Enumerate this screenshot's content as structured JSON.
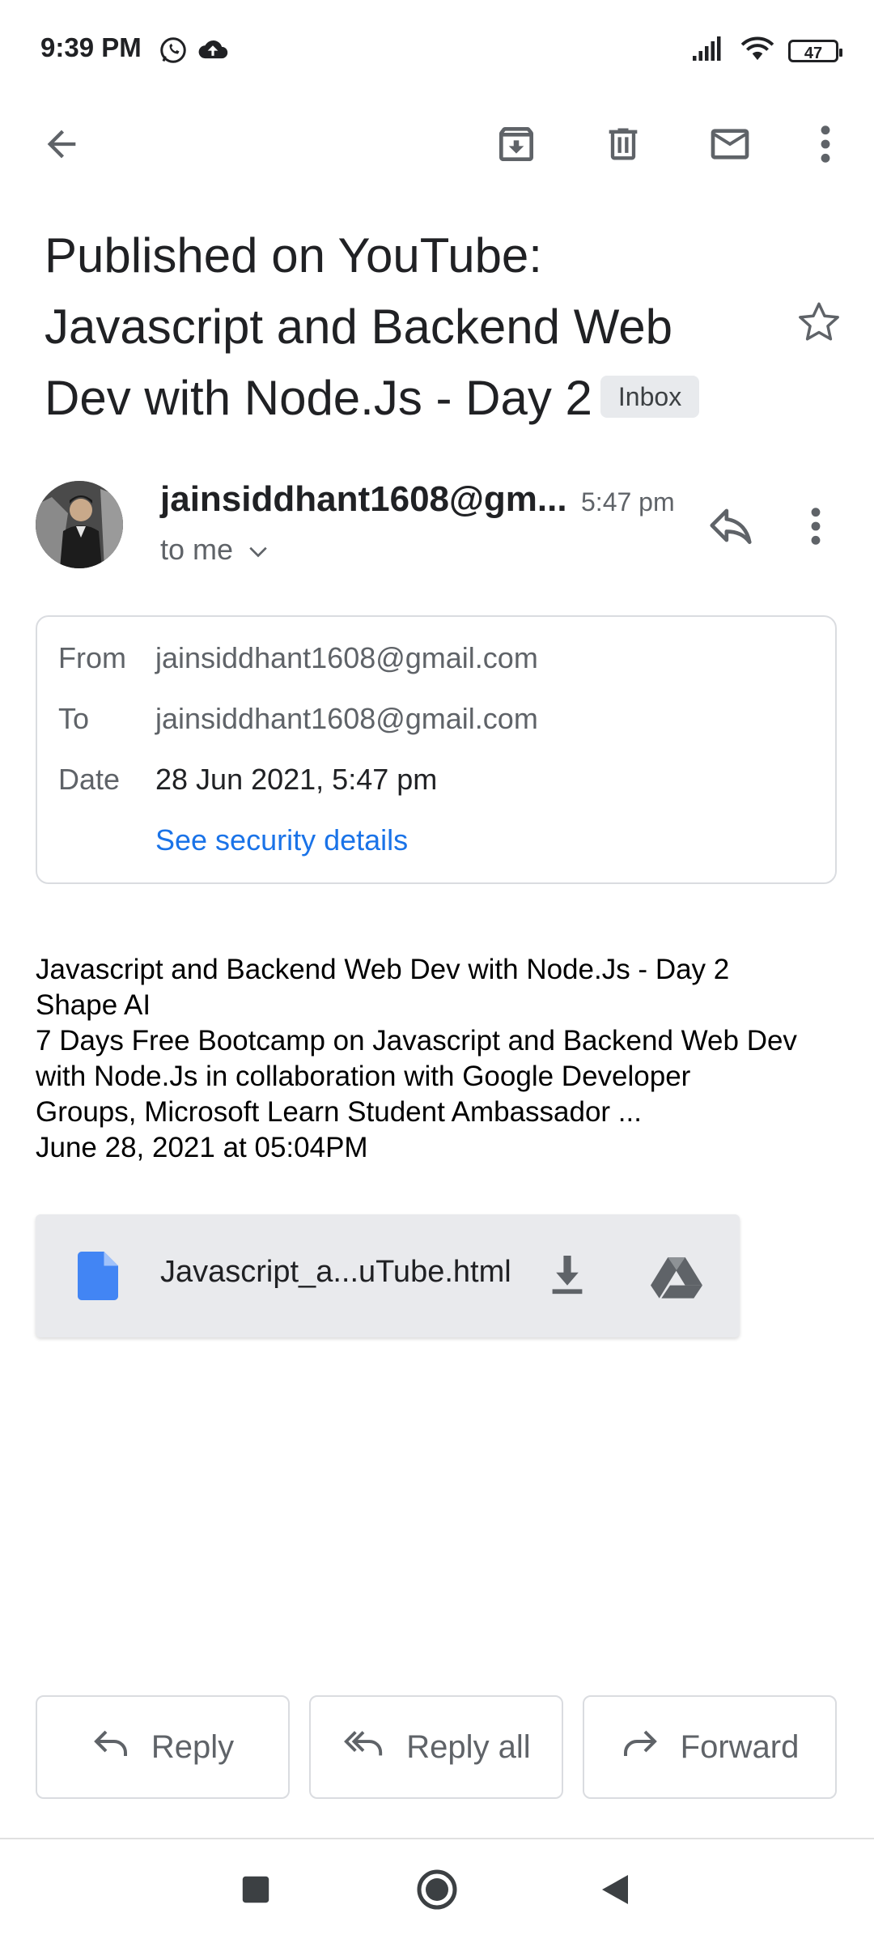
{
  "status_bar": {
    "time": "9:39 PM",
    "battery": "47"
  },
  "toolbar": {
    "back": "back",
    "archive": "archive",
    "delete": "delete",
    "mark_unread": "mark-unread",
    "more": "more"
  },
  "email": {
    "subject_lines": [
      "Published on YouTube:",
      "Javascript and Backend Web",
      "Dev with Node.Js - Day 2"
    ],
    "label": "Inbox",
    "sender_display": "jainsiddhant1608@gm...",
    "time": "5:47 pm",
    "to_me": "to me",
    "details": {
      "from_label": "From",
      "from_value": "jainsiddhant1608@gmail.com",
      "to_label": "To",
      "to_value": "jainsiddhant1608@gmail.com",
      "date_label": "Date",
      "date_value": "28 Jun 2021, 5:47 pm",
      "security_link": "See security details"
    },
    "body_lines": [
      "Javascript and Backend Web Dev with Node.Js - Day 2",
      "Shape AI",
      "7 Days Free Bootcamp on Javascript and Backend Web Dev",
      "with Node.Js in collaboration with Google Developer",
      "Groups, Microsoft Learn Student Ambassador ...",
      "June 28, 2021 at 05:04PM"
    ],
    "attachment": {
      "name": "Javascript_a...uTube.html"
    }
  },
  "actions": {
    "reply": "Reply",
    "reply_all": "Reply all",
    "forward": "Forward"
  },
  "colors": {
    "accent": "#1a73e8",
    "file_icon": "#4285f4",
    "chip_bg": "#e8eaed",
    "attachment_bg": "#e9eaed"
  }
}
